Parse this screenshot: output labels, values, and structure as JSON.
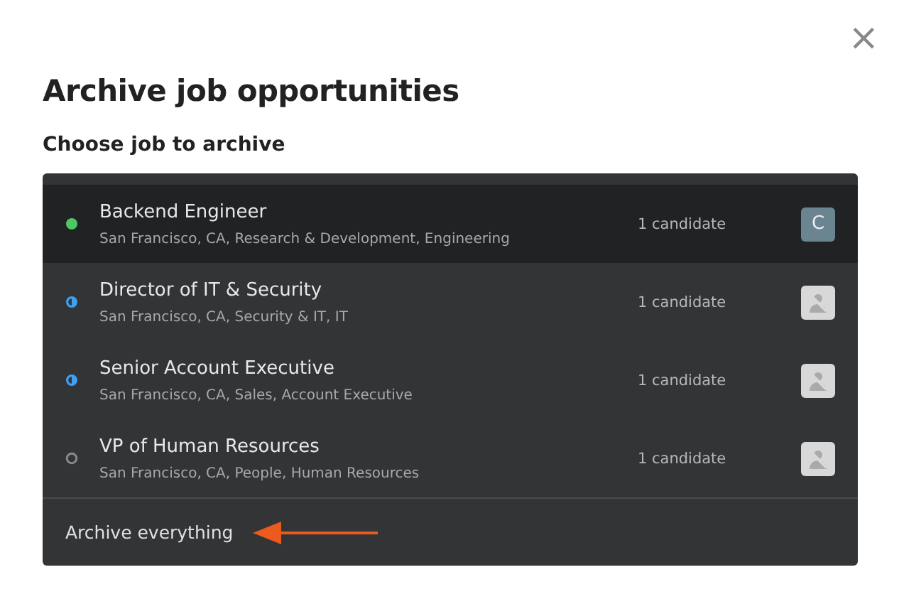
{
  "dialog": {
    "title": "Archive job opportunities",
    "close": "×"
  },
  "section_label": "Choose job to archive",
  "jobs": [
    {
      "title": "Backend Engineer",
      "details": "San Francisco, CA, Research & Development, Engineering",
      "count": "1 candidate",
      "kind": "filled",
      "color": "#4cc764",
      "selected": true,
      "avatar": {
        "kind": "letter",
        "text": "C"
      }
    },
    {
      "title": "Director of IT & Security",
      "details": "San Francisco, CA, Security & IT, IT",
      "count": "1 candidate",
      "kind": "half",
      "color": "#3ea1f2",
      "selected": false,
      "avatar": {
        "kind": "placeholder"
      }
    },
    {
      "title": "Senior Account Executive",
      "details": "San Francisco, CA, Sales, Account Executive",
      "count": "1 candidate",
      "kind": "half",
      "color": "#3ea1f2",
      "selected": false,
      "avatar": {
        "kind": "placeholder"
      }
    },
    {
      "title": "VP of Human Resources",
      "details": "San Francisco, CA, People, Human Resources",
      "count": "1 candidate",
      "kind": "hollow",
      "color": "#8a8a8a",
      "selected": false,
      "avatar": {
        "kind": "placeholder"
      }
    }
  ],
  "archive_all": "Archive everything"
}
